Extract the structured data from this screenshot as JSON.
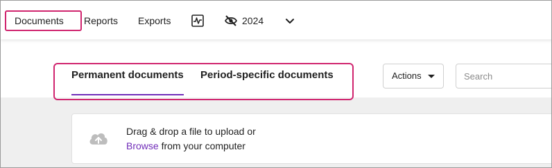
{
  "topnav": {
    "items": [
      {
        "label": "Documents"
      },
      {
        "label": "Reports"
      },
      {
        "label": "Exports"
      }
    ],
    "year": "2024",
    "icons": [
      "activity-icon",
      "eye-off-icon",
      "chevron-down-icon"
    ]
  },
  "tabs": [
    {
      "label": "Permanent documents",
      "active": true
    },
    {
      "label": "Period-specific documents",
      "active": false
    }
  ],
  "toolbar": {
    "actions_label": "Actions",
    "search_placeholder": "Search"
  },
  "upload": {
    "line1": "Drag & drop a file to upload or",
    "browse": "Browse",
    "line2_rest": " from your computer"
  },
  "colors": {
    "highlight": "#d0246e",
    "accent": "#6f2bb8",
    "content_bg": "#efefef"
  }
}
